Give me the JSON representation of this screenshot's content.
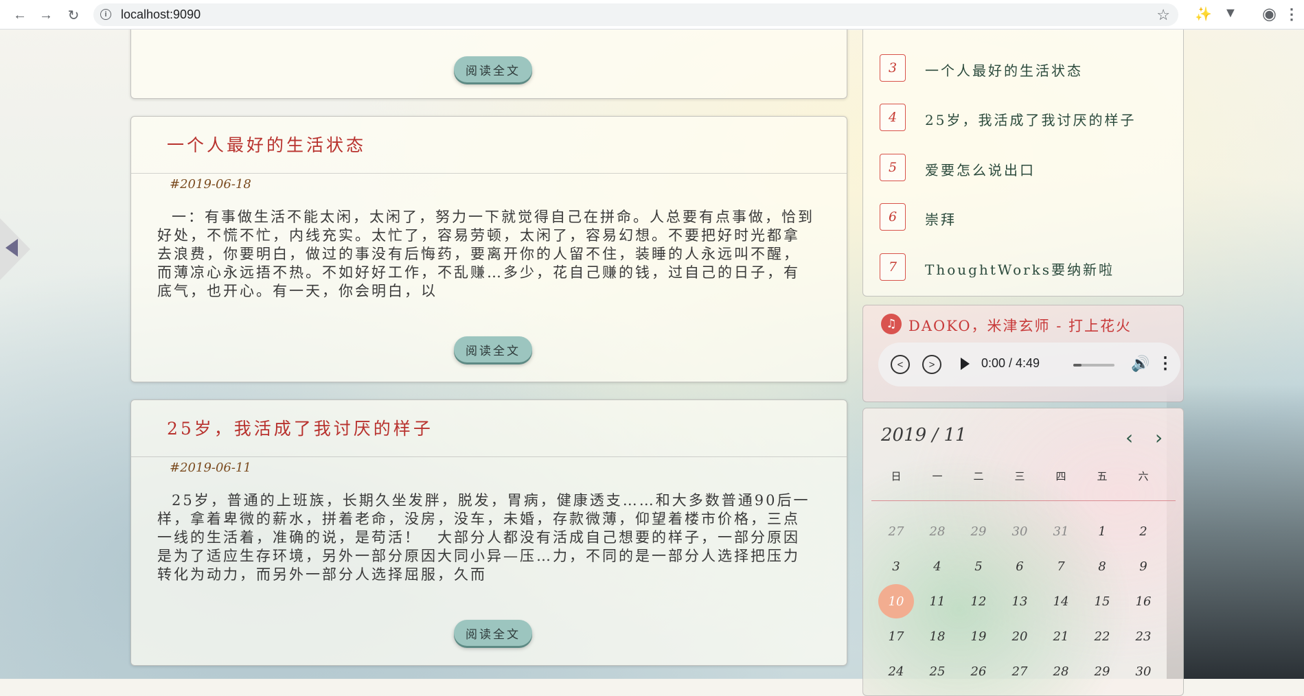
{
  "browser": {
    "url": "localhost:9090"
  },
  "articles": [
    {
      "title": "",
      "date": "",
      "excerpt": "",
      "read_label": "阅读全文"
    },
    {
      "title": "一个人最好的生活状态",
      "date": "#2019-06-18",
      "excerpt": "一：有事做生活不能太闲，太闲了，努力一下就觉得自己在拼命。人总要有点事做，恰到好处，不慌不忙，内线充实。太忙了，容易劳顿，太闲了，容易幻想。不要把好时光都拿去浪费，你要明白，做过的事没有后悔药，要离开你的人留不住，装睡的人永远叫不醒，而薄凉心永远捂不热。不如好好工作，不乱赚…多少，花自己赚的钱，过自己的日子，有底气，也开心。有一天，你会明白，以",
      "read_label": "阅读全文"
    },
    {
      "title": "25岁，我活成了我讨厌的样子",
      "date": "#2019-06-11",
      "excerpt": "25岁，普通的上班族，长期久坐发胖，脱发，胃病，健康透支……和大多数普通90后一样，拿着卑微的薪水，拼着老命，没房，没车，未婚，存款微薄，仰望着楼市价格，三点一线的生活着，准确的说，是苟活！　大部分人都没有活成自己想要的样子，一部分原因是为了适应生存环境，另外一部分原因大同小异—压…力，不同的是一部分人选择把压力转化为动力，而另外一部分人选择屈服，久而",
      "read_label": "阅读全文"
    }
  ],
  "ranking": [
    {
      "num": "3",
      "title": "一个人最好的生活状态"
    },
    {
      "num": "4",
      "title": "25岁，我活成了我讨厌的样子"
    },
    {
      "num": "5",
      "title": "爱要怎么说出口"
    },
    {
      "num": "6",
      "title": "崇拜"
    },
    {
      "num": "7",
      "title": "ThoughtWorks要纳新啦"
    }
  ],
  "music": {
    "title": "DAOKO，米津玄师 - 打上花火",
    "time": "0:00 / 4:49",
    "progress": 0.2,
    "icons": {
      "note": "music-note-icon",
      "prev": "prev-circle-icon",
      "next": "next-circle-icon",
      "play": "play-icon",
      "volume": "volume-icon",
      "more": "more-vert-icon"
    }
  },
  "calendar": {
    "month_label": "2019 / 11",
    "weekdays": [
      "日",
      "一",
      "二",
      "三",
      "四",
      "五",
      "六"
    ],
    "weeks": [
      [
        "27",
        "28",
        "29",
        "30",
        "31",
        "1",
        "2"
      ],
      [
        "3",
        "4",
        "5",
        "6",
        "7",
        "8",
        "9"
      ],
      [
        "10",
        "11",
        "12",
        "13",
        "14",
        "15",
        "16"
      ],
      [
        "17",
        "18",
        "19",
        "20",
        "21",
        "22",
        "23"
      ],
      [
        "24",
        "25",
        "26",
        "27",
        "28",
        "29",
        "30"
      ]
    ],
    "prev_month_count": 5,
    "today": "10",
    "colors": {
      "today_bg": "#f2ad90",
      "accent": "#d8524a"
    }
  }
}
